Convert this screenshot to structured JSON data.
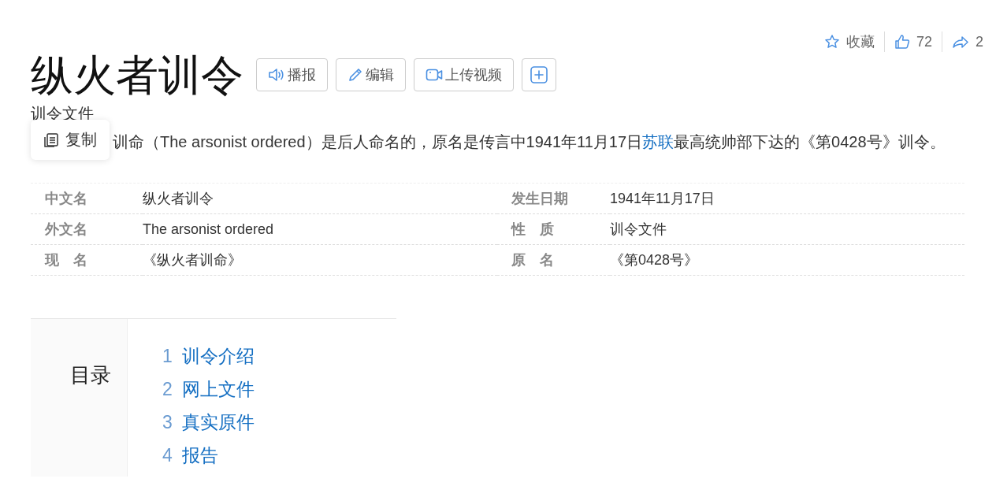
{
  "actions": [
    {
      "kind": "favorite",
      "label": "收藏"
    },
    {
      "kind": "like",
      "label": "72"
    },
    {
      "kind": "share",
      "label": "2"
    }
  ],
  "title": "纵火者训令",
  "tools": [
    {
      "kind": "speaker",
      "label": "播报"
    },
    {
      "kind": "pencil",
      "label": "编辑"
    },
    {
      "kind": "video",
      "label": "上传视频"
    },
    {
      "kind": "plus"
    }
  ],
  "subtitle": "训令文件",
  "copy_popup": {
    "label": "复制"
  },
  "summary": {
    "before": "训命（The arsonist ordered）是后人命名的，原名是传言中1941年11月17日",
    "link": "苏联",
    "after": "最高统帅部下达的《第0428号》训令。"
  },
  "info": [
    {
      "label": "中文名",
      "value": "纵火者训令"
    },
    {
      "label": "发生日期",
      "value": "1941年11月17日"
    },
    {
      "label": "外文名",
      "value": "The arsonist ordered"
    },
    {
      "label": "性　质",
      "value": "训令文件"
    },
    {
      "label": "现　名",
      "value": "《纵火者训命》"
    },
    {
      "label": "原　名",
      "value": "《第0428号》"
    }
  ],
  "toc": {
    "title": "目录",
    "items": [
      {
        "number": "1",
        "label": "训令介绍"
      },
      {
        "number": "2",
        "label": "网上文件"
      },
      {
        "number": "3",
        "label": "真实原件"
      },
      {
        "number": "4",
        "label": "报告"
      }
    ]
  }
}
